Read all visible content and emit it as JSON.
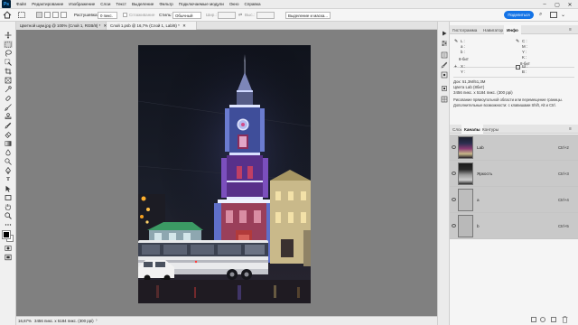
{
  "menu": {
    "logo": "Ps",
    "items": [
      "Файл",
      "Редактирование",
      "Изображение",
      "Слои",
      "Текст",
      "Выделение",
      "Фильтр",
      "Подключаемые модули",
      "Окно",
      "Справка"
    ],
    "minimize": "–",
    "maximize": "▢",
    "close": "✕"
  },
  "options": {
    "feather_label": "Растушевка:",
    "feather_value": "0 пикс.",
    "antialias_label": "Сглаживание",
    "style_label": "Стиль:",
    "style_value": "Обычный",
    "width_label": "Шир.:",
    "height_label": "Выс.:",
    "select_mask_label": "Выделение и маска...",
    "share_label": "Поделиться"
  },
  "document_tabs": [
    {
      "label": "Цветной шум.jpg @ 100% (Слой 1, RGB/8) *",
      "close": "✕"
    },
    {
      "label": "Слой 1.psb @ 16,7% (Слой 1, Lab/8) *",
      "close": "✕"
    }
  ],
  "status": {
    "text": "16,67%",
    "doc_info": "3456 пикс. x 5184 пикс. (300 ppi)"
  },
  "info_panel": {
    "tabs": [
      "Гистограмма",
      "Навигатор",
      "Инфо"
    ],
    "active_tab": "Инфо",
    "l_label": "L :",
    "a_label": "a :",
    "b_label": "b :",
    "bitdepth_left": "8-бит",
    "c_label": "C :",
    "m_label": "M :",
    "y_label": "Y :",
    "k_label": "K :",
    "bitdepth_right": "8-бит",
    "x_label": "X :",
    "y_coord_label": "Y :",
    "w_label": "Ш :",
    "h_label": "В :",
    "doc_line": "Док: 51,3M/51,3M",
    "color_line": "Цвета Lab (8бит)",
    "size_line": "3456 пикс. x 5184 пикс. (300 ppi)",
    "hint_line1": "Рисование прямоугольной области или перемещение границы.",
    "hint_line2": "Дополнительные возможности: с клавишами Shift, Alt и Ctrl."
  },
  "channels_panel": {
    "tabs": [
      "Слои",
      "Каналы",
      "Контуры"
    ],
    "active_tab": "Каналы",
    "channels": [
      {
        "name": "Lab",
        "shortcut": "Ctrl+2"
      },
      {
        "name": "Яркость",
        "shortcut": "Ctrl+3"
      },
      {
        "name": "a",
        "shortcut": "Ctrl+4"
      },
      {
        "name": "b",
        "shortcut": "Ctrl+5"
      }
    ]
  },
  "colors": {
    "accent": "#1473e6",
    "workspace": "#808080",
    "ps_blue": "#31a8ff"
  }
}
